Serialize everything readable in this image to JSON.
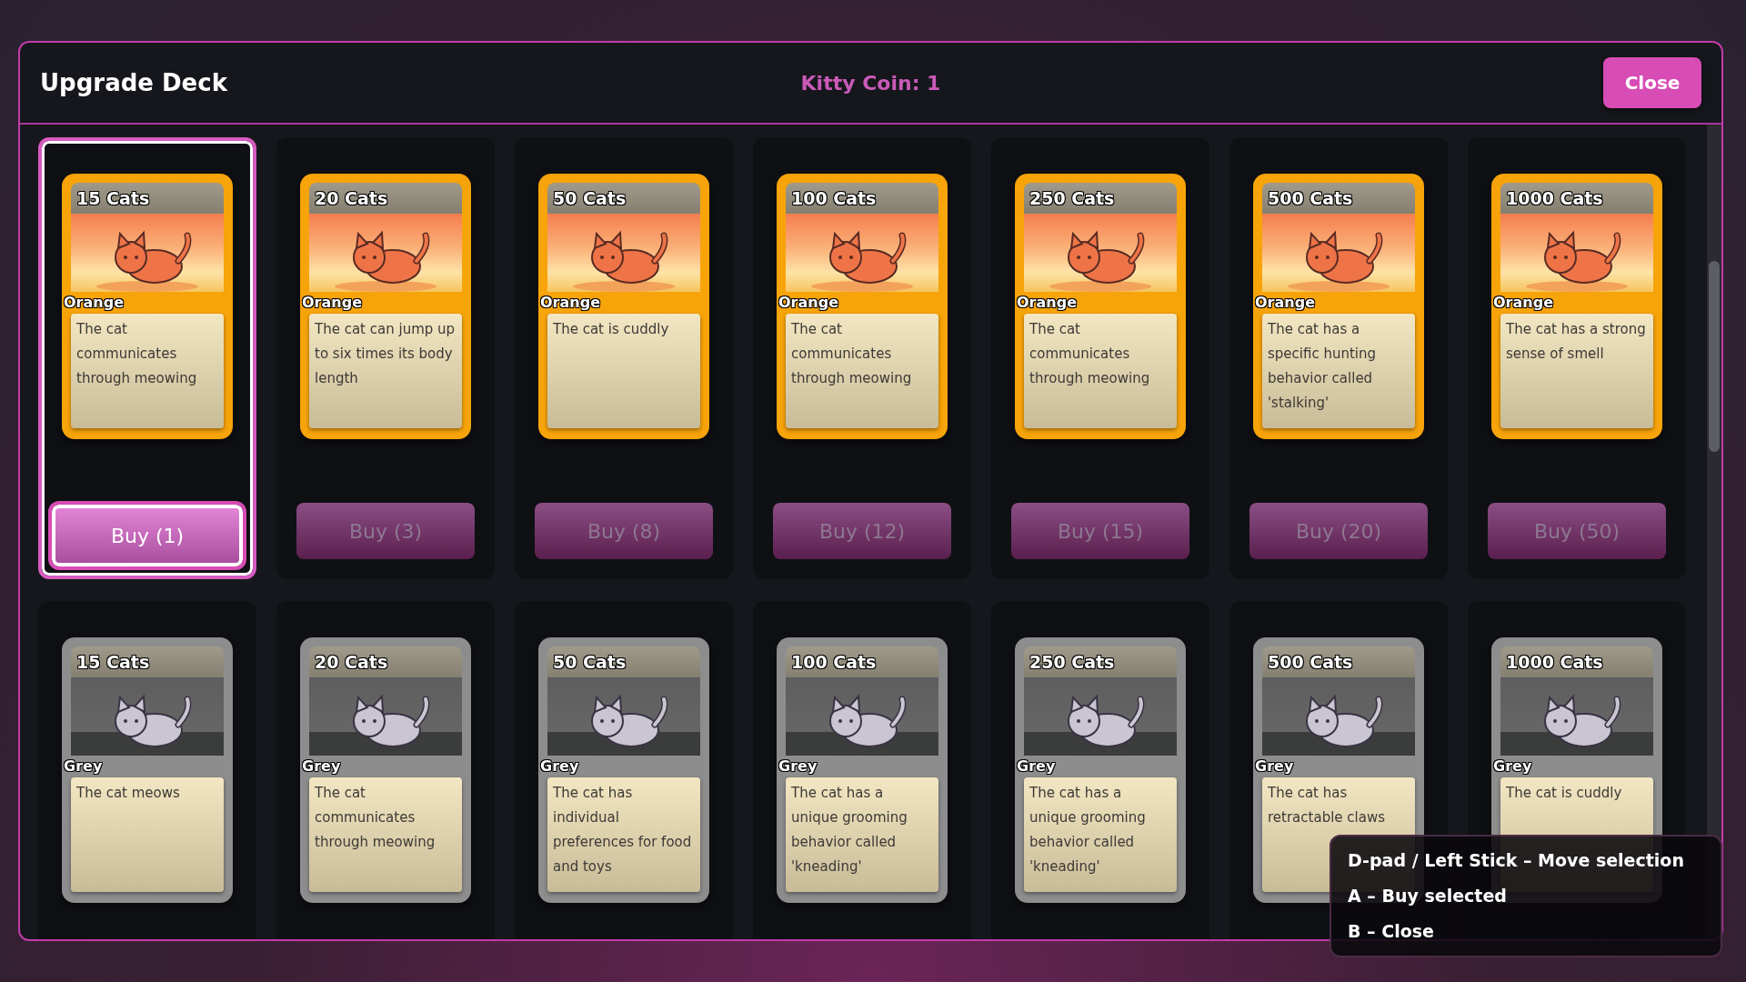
{
  "header": {
    "title": "Upgrade Deck",
    "coins": "Kitty Coin: 1",
    "close": "Close"
  },
  "rows": [
    {
      "slots": [
        {
          "selected": true,
          "card": {
            "kind": "orange",
            "count": "15 Cats",
            "label": "Orange",
            "text": "The cat communicates through meowing"
          },
          "buy": {
            "label": "Buy (1)",
            "disabled": false
          }
        },
        {
          "selected": false,
          "card": {
            "kind": "orange",
            "count": "20 Cats",
            "label": "Orange",
            "text": "The cat can jump up to six times its body length"
          },
          "buy": {
            "label": "Buy (3)",
            "disabled": true
          }
        },
        {
          "selected": false,
          "card": {
            "kind": "orange",
            "count": "50 Cats",
            "label": "Orange",
            "text": "The cat is cuddly"
          },
          "buy": {
            "label": "Buy (8)",
            "disabled": true
          }
        },
        {
          "selected": false,
          "card": {
            "kind": "orange",
            "count": "100 Cats",
            "label": "Orange",
            "text": "The cat communicates through meowing"
          },
          "buy": {
            "label": "Buy (12)",
            "disabled": true
          }
        },
        {
          "selected": false,
          "card": {
            "kind": "orange",
            "count": "250 Cats",
            "label": "Orange",
            "text": "The cat communicates through meowing"
          },
          "buy": {
            "label": "Buy (15)",
            "disabled": true
          }
        },
        {
          "selected": false,
          "card": {
            "kind": "orange",
            "count": "500 Cats",
            "label": "Orange",
            "text": "The cat has a specific hunting behavior called 'stalking'"
          },
          "buy": {
            "label": "Buy (20)",
            "disabled": true
          }
        },
        {
          "selected": false,
          "card": {
            "kind": "orange",
            "count": "1000 Cats",
            "label": "Orange",
            "text": "The cat has a strong sense of smell"
          },
          "buy": {
            "label": "Buy (50)",
            "disabled": true
          }
        }
      ]
    },
    {
      "slots": [
        {
          "selected": false,
          "card": {
            "kind": "grey",
            "count": "15 Cats",
            "label": "Grey",
            "text": "The cat meows"
          }
        },
        {
          "selected": false,
          "card": {
            "kind": "grey",
            "count": "20 Cats",
            "label": "Grey",
            "text": "The cat communicates through meowing"
          }
        },
        {
          "selected": false,
          "card": {
            "kind": "grey",
            "count": "50 Cats",
            "label": "Grey",
            "text": "The cat has individual preferences for food and toys"
          }
        },
        {
          "selected": false,
          "card": {
            "kind": "grey",
            "count": "100 Cats",
            "label": "Grey",
            "text": "The cat has a unique grooming behavior called 'kneading'"
          }
        },
        {
          "selected": false,
          "card": {
            "kind": "grey",
            "count": "250 Cats",
            "label": "Grey",
            "text": "The cat has a unique grooming behavior called 'kneading'"
          }
        },
        {
          "selected": false,
          "card": {
            "kind": "grey",
            "count": "500 Cats",
            "label": "Grey",
            "text": "The cat has retractable claws"
          }
        },
        {
          "selected": false,
          "card": {
            "kind": "grey",
            "count": "1000 Cats",
            "label": "Grey",
            "text": "The cat is cuddly"
          }
        }
      ]
    }
  ],
  "help": [
    "D-pad / Left Stick – Move selection",
    "A – Buy selected",
    "B – Close"
  ]
}
